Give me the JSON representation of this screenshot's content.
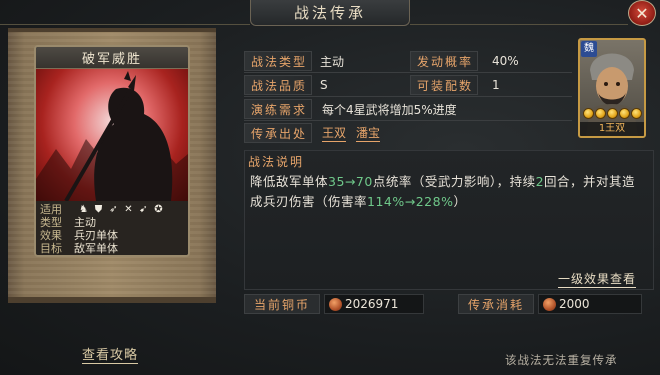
{
  "window": {
    "title": "战法传承",
    "close_icon": "close-icon"
  },
  "skill_card": {
    "name": "破军威胜",
    "use_label": "适用",
    "use_icons": [
      "horse-icon",
      "shield-icon",
      "bow-icon",
      "spear-icon",
      "crossbow-icon",
      "chariot-icon"
    ],
    "rows": [
      {
        "key": "类型",
        "value": "主动"
      },
      {
        "key": "效果",
        "value": "兵刃单体"
      },
      {
        "key": "目标",
        "value": "敌军单体"
      }
    ]
  },
  "details": {
    "type_label": "战法类型",
    "type_value": "主动",
    "rate_label": "发动概率",
    "rate_value": "40%",
    "quality_label": "战法品质",
    "quality_value": "S",
    "slots_label": "可装配数",
    "slots_value": "1",
    "drill_label": "演练需求",
    "drill_value": "每个4星武将增加5%进度",
    "source_label": "传承出处",
    "sources": [
      "王双",
      "潘宝"
    ]
  },
  "description": {
    "title": "战法说明",
    "part1": "降低敌军单体",
    "range1": "35→70",
    "part2": "点统率（受武力影响），持续",
    "turns": "2",
    "part3": "回合，并对其造成兵刃伤害（伤害率",
    "range2": "114%→228%",
    "part4": "）"
  },
  "level_link": "一级效果查看",
  "coins": {
    "current_label": "当前铜币",
    "current_value": "2026971",
    "cost_label": "传承消耗",
    "cost_value": "2000"
  },
  "general": {
    "faction": "魏",
    "stars": 5,
    "name": "1王双"
  },
  "strategy_link": "查看攻略",
  "footer_note": "该战法无法重复传承",
  "colors": {
    "label_orange": "#e6a46a",
    "highlight_green": "#6fc88a",
    "faction_blue": "#2c4c93"
  }
}
